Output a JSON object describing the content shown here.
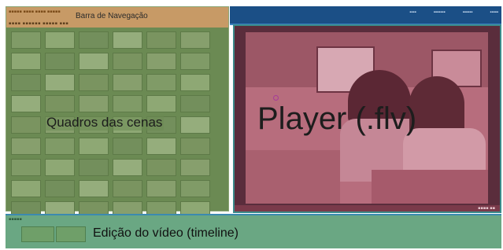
{
  "navigation": {
    "title": "Barra de Navegação",
    "small_header": "▪▪▪▪▪ ▪▪▪▪ ▪▪▪▪ ▪▪▪▪▪",
    "menu_row": "▪▪▪▪ ▪▪▪▪▪▪ ▪▪▪▪▪ ▪▪▪"
  },
  "top_links": [
    "▪▪▪▪",
    "▪▪▪▪▪▪▪",
    "▪▪▪▪▪▪",
    "▪▪▪▪▪"
  ],
  "scenes": {
    "label": "Quadros das cenas",
    "thumbnail_count": 54
  },
  "player": {
    "label": "Player (.flv)",
    "controls": "▪▪▪▪ ▪▪"
  },
  "timeline": {
    "label": "Edição do vídeo (timeline)",
    "header": "▪▪▪▪▪",
    "clip_count": 2
  },
  "colors": {
    "nav_bar": "#c79a66",
    "scenes_panel": "#6b8a53",
    "player_overlay": "#b76d7d",
    "timeline": "#6aa783",
    "top_bar": "#1b4f86"
  }
}
